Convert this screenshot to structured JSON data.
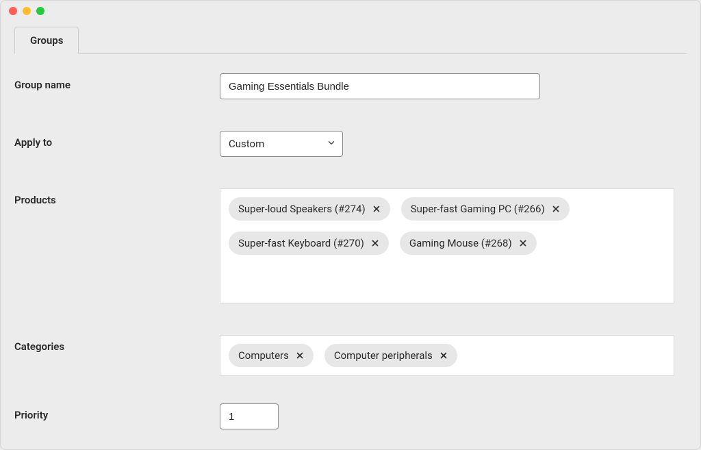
{
  "tabs": {
    "groups": "Groups"
  },
  "labels": {
    "group_name": "Group name",
    "apply_to": "Apply to",
    "products": "Products",
    "categories": "Categories",
    "priority": "Priority"
  },
  "fields": {
    "group_name_value": "Gaming Essentials Bundle",
    "apply_to_value": "Custom",
    "priority_value": "1"
  },
  "products": [
    "Super-loud Speakers (#274)",
    "Super-fast Gaming PC (#266)",
    "Super-fast Keyboard (#270)",
    "Gaming Mouse (#268)"
  ],
  "categories": [
    "Computers",
    "Computer peripherals"
  ]
}
